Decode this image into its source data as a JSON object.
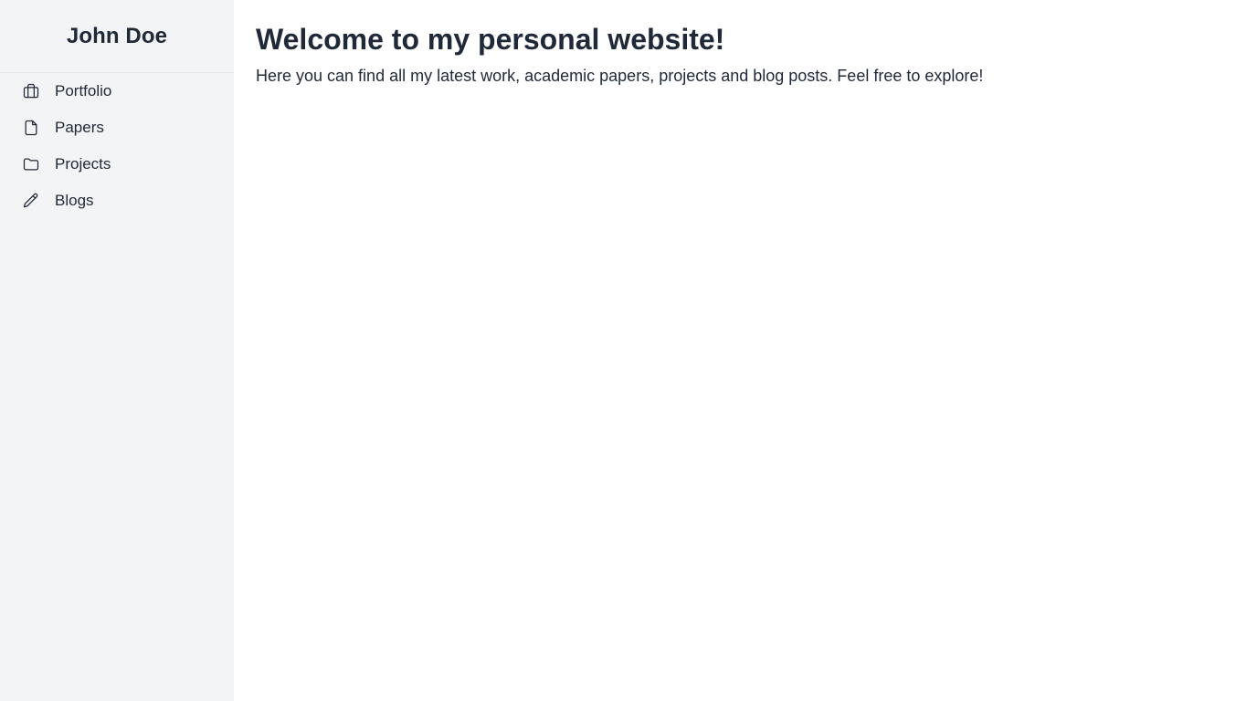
{
  "sidebar": {
    "site_name": "John Doe",
    "items": [
      {
        "label": "Portfolio",
        "icon": "briefcase-icon"
      },
      {
        "label": "Papers",
        "icon": "document-icon"
      },
      {
        "label": "Projects",
        "icon": "folder-icon"
      },
      {
        "label": "Blogs",
        "icon": "pencil-icon"
      }
    ]
  },
  "main": {
    "title": "Welcome to my personal website!",
    "intro": "Here you can find all my latest work, academic papers, projects and blog posts. Feel free to explore!"
  },
  "colors": {
    "sidebar_bg": "#f3f4f6",
    "text": "#1f2937",
    "divider": "#e5e7eb"
  }
}
